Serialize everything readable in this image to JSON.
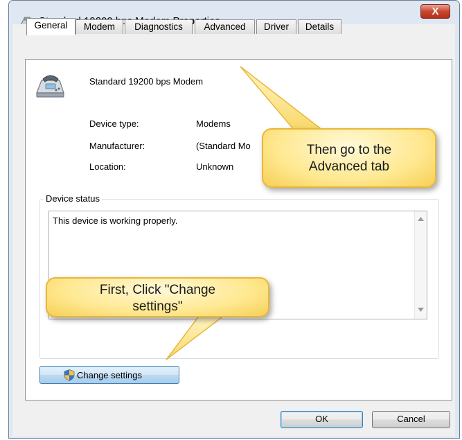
{
  "window": {
    "title": "Standard 19200 bps Modem Properties",
    "close_label": "X"
  },
  "tabs": [
    {
      "label": "General",
      "active": true
    },
    {
      "label": "Modem",
      "active": false
    },
    {
      "label": "Diagnostics",
      "active": false
    },
    {
      "label": "Advanced",
      "active": false
    },
    {
      "label": "Driver",
      "active": false
    },
    {
      "label": "Details",
      "active": false
    }
  ],
  "general": {
    "device_name": "Standard 19200 bps Modem",
    "device_type_label": "Device type:",
    "device_type_value": "Modems",
    "manufacturer_label": "Manufacturer:",
    "manufacturer_value": "(Standard Mo",
    "location_label": "Location:",
    "location_value": "Unknown",
    "device_status_label": "Device status",
    "device_status_text": "This device is working properly.",
    "change_settings_label": "Change settings"
  },
  "footer": {
    "ok_label": "OK",
    "cancel_label": "Cancel"
  },
  "callouts": {
    "advanced_tab_note": [
      "Then go to the",
      "Advanced tab"
    ],
    "change_settings_note": [
      "First, Click \"Change",
      "settings\""
    ]
  },
  "colors": {
    "callout_fill": "#ffe890",
    "callout_border": "#e8b73a",
    "close_button": "#c9462f",
    "change_button": "#b9d6f0"
  },
  "icons": {
    "title": "modem-icon",
    "device": "modem-telephone-icon",
    "change_settings": "uac-shield-icon",
    "close": "close-icon"
  }
}
